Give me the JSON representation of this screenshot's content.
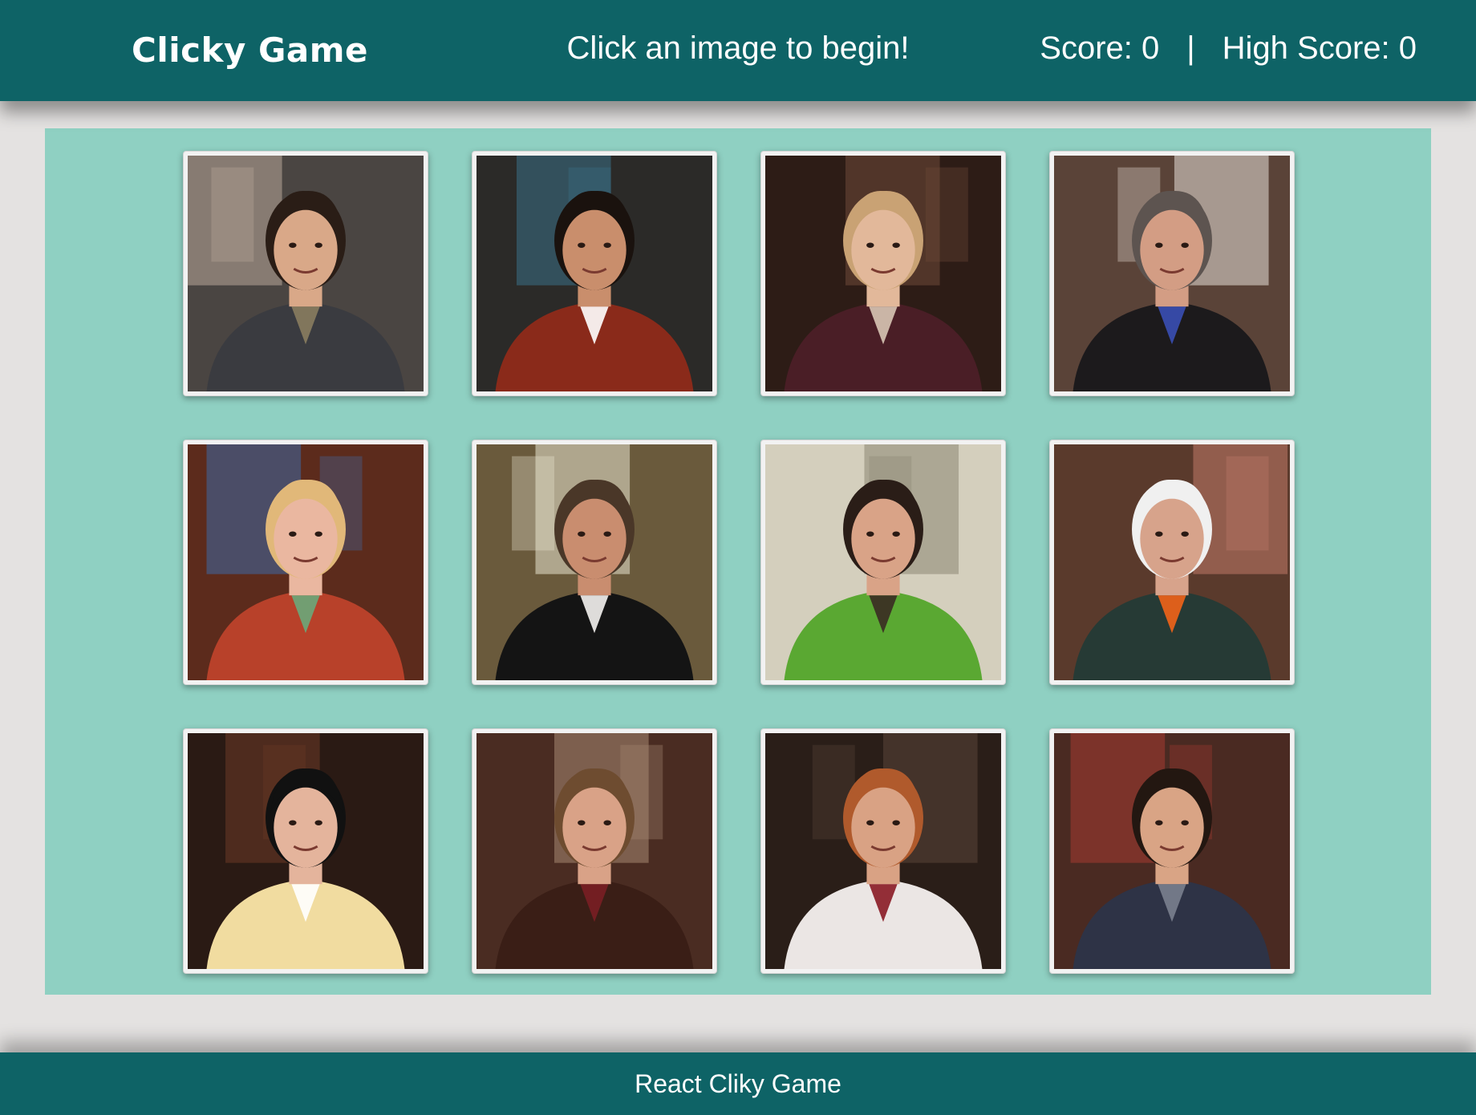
{
  "navbar": {
    "brand": "Clicky Game",
    "message": "Click an image to begin!",
    "score_text": "Score: 0",
    "separator": "|",
    "high_score_text": "High Score: 0"
  },
  "game": {
    "score": 0,
    "high_score": 0,
    "cards": [
      {
        "name": "card-1",
        "colors": {
          "bg": "#4a4542",
          "bg2": "#b9a89a",
          "skin": "#d9a888",
          "hair": "#2a1d16",
          "shirt": "#3a3b40",
          "accent": "#8a7d5f"
        }
      },
      {
        "name": "card-2",
        "colors": {
          "bg": "#2b2a28",
          "bg2": "#3a6f86",
          "skin": "#c98e6c",
          "hair": "#1a120e",
          "shirt": "#8a2a1a",
          "accent": "#ffffff"
        }
      },
      {
        "name": "card-3",
        "colors": {
          "bg": "#2d1c16",
          "bg2": "#6f4a3a",
          "skin": "#e2b89a",
          "hair": "#c9a274",
          "shirt": "#4a1e26",
          "accent": "#d8c5b5"
        }
      },
      {
        "name": "card-4",
        "colors": {
          "bg": "#5a4338",
          "bg2": "#e8e0d8",
          "skin": "#d39d84",
          "hair": "#5d5450",
          "shirt": "#1c1a1c",
          "accent": "#3a4fb5"
        }
      },
      {
        "name": "card-5",
        "colors": {
          "bg": "#5c2b1c",
          "bg2": "#3e6aa6",
          "skin": "#eab7a0",
          "hair": "#e1b879",
          "shirt": "#b8412a",
          "accent": "#6aa97a"
        }
      },
      {
        "name": "card-6",
        "colors": {
          "bg": "#6a5a3c",
          "bg2": "#e7e5d0",
          "skin": "#c98d6f",
          "hair": "#4a3728",
          "shirt": "#141414",
          "accent": "#f4f2ef"
        }
      },
      {
        "name": "card-7",
        "colors": {
          "bg": "#d4cfbd",
          "bg2": "#8a8673",
          "skin": "#d9a387",
          "hair": "#2a1d17",
          "shirt": "#5aa832",
          "accent": "#3a2a22"
        }
      },
      {
        "name": "card-8",
        "colors": {
          "bg": "#5a3a2c",
          "bg2": "#c17a6a",
          "skin": "#d7a38b",
          "hair": "#f0f0f0",
          "shirt": "#263a35",
          "accent": "#f26418"
        }
      },
      {
        "name": "card-9",
        "colors": {
          "bg": "#2a1a14",
          "bg2": "#6c3a26",
          "skin": "#e4b49c",
          "hair": "#111111",
          "shirt": "#f1dca0",
          "accent": "#ffffff"
        }
      },
      {
        "name": "card-10",
        "colors": {
          "bg": "#4a2c22",
          "bg2": "#a78a72",
          "skin": "#d9a287",
          "hair": "#6e4c30",
          "shirt": "#3a1e16",
          "accent": "#7a1e24"
        }
      },
      {
        "name": "card-11",
        "colors": {
          "bg": "#2a1e18",
          "bg2": "#5a463a",
          "skin": "#d9a284",
          "hair": "#b05a2c",
          "shirt": "#ebe6e4",
          "accent": "#8a1a24"
        }
      },
      {
        "name": "card-12",
        "colors": {
          "bg": "#4a2a22",
          "bg2": "#a63a32",
          "skin": "#d9a485",
          "hair": "#231711",
          "shirt": "#2e3346",
          "accent": "#7a7f8e"
        }
      }
    ]
  },
  "footer": {
    "text": "React Cliky Game"
  },
  "theme": {
    "navbar": "#0e6366",
    "board": "#8fd0c2",
    "page": "#e4e2e1",
    "text": "#ffffff"
  }
}
